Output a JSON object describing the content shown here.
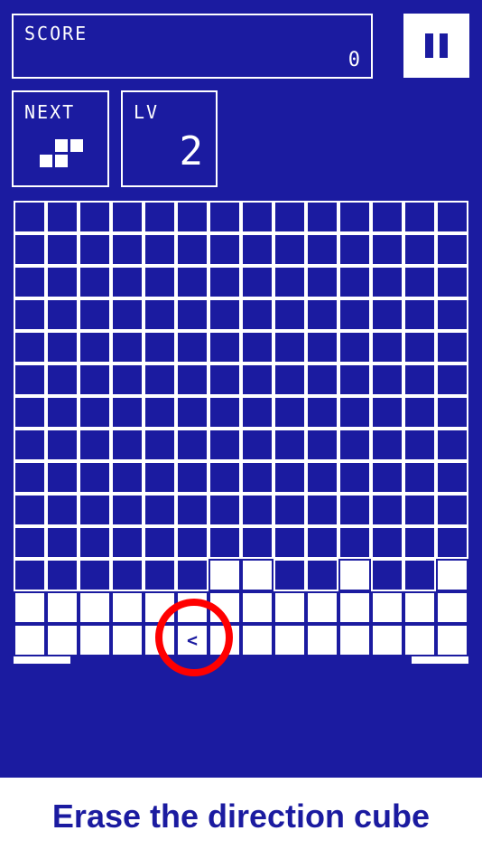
{
  "hud": {
    "score_label": "SCORE",
    "score_value": "0",
    "next_label": "NEXT",
    "level_label": "LV",
    "level_value": "2"
  },
  "next_piece": "S-tetromino",
  "board": {
    "columns": 14,
    "rows": 14,
    "filled_row_11": [
      6,
      7,
      10,
      13
    ],
    "filled_row_12": [
      0,
      1,
      2,
      3,
      4,
      5,
      6,
      7,
      8,
      9,
      10,
      11,
      12,
      13
    ],
    "filled_row_13": [
      0,
      1,
      2,
      3,
      4,
      5,
      6,
      7,
      8,
      9,
      10,
      11,
      12,
      13
    ],
    "direction_cube": {
      "row": 13,
      "col": 5,
      "symbol": "<"
    }
  },
  "caption": "Erase the direction cube",
  "colors": {
    "background": "#1b1ba0",
    "block": "#ffffff",
    "highlight_ring": "#ff0000"
  }
}
